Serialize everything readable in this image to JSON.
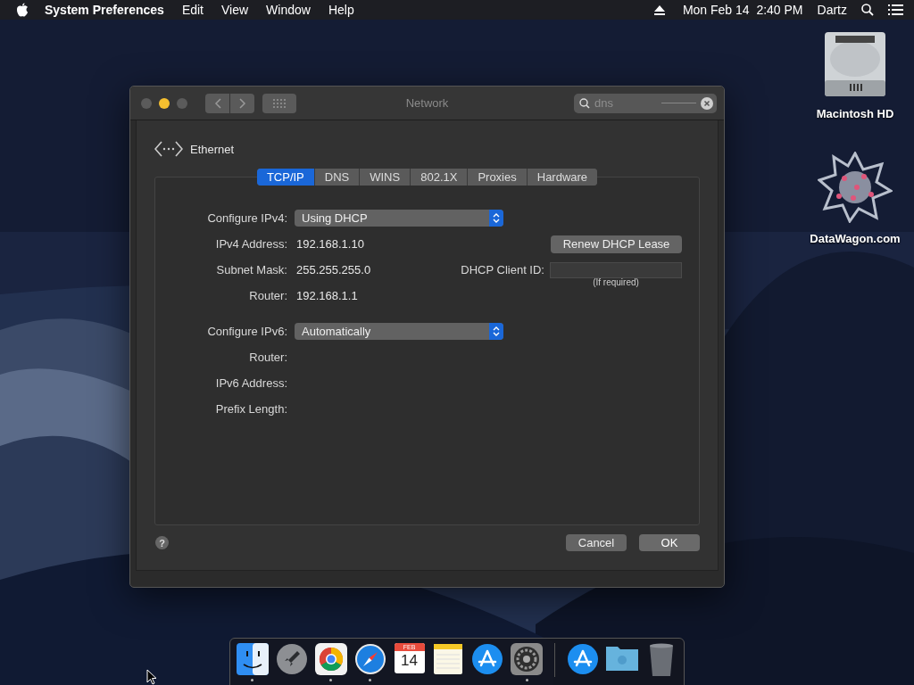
{
  "menu_bar": {
    "app_name": "System Preferences",
    "menus": [
      "Edit",
      "View",
      "Window",
      "Help"
    ],
    "clock": "Mon Feb 14  2:40 PM",
    "user": "Dartz"
  },
  "desktop_icons": [
    {
      "kind": "drive",
      "label": "Macintosh HD"
    },
    {
      "kind": "star",
      "label": "DataWagon.com"
    }
  ],
  "window": {
    "title": "Network",
    "search": {
      "value": "dns"
    },
    "service": "Ethernet",
    "tabs": [
      {
        "label": "TCP/IP",
        "selected": true
      },
      {
        "label": "DNS",
        "selected": false
      },
      {
        "label": "WINS",
        "selected": false
      },
      {
        "label": "802.1X",
        "selected": false
      },
      {
        "label": "Proxies",
        "selected": false
      },
      {
        "label": "Hardware",
        "selected": false
      }
    ],
    "ipv4_rows": [
      {
        "label": "Configure IPv4:",
        "kind": "popup",
        "value": "Using DHCP"
      },
      {
        "label": "IPv4 Address:",
        "kind": "text",
        "value": "192.168.1.10"
      },
      {
        "label": "Subnet Mask:",
        "kind": "text",
        "value": "255.255.255.0"
      },
      {
        "label": "Router:",
        "kind": "text",
        "value": "192.168.1.1"
      }
    ],
    "renew_button": "Renew DHCP Lease",
    "client_id": {
      "label": "DHCP Client ID:",
      "hint": "(If required)"
    },
    "ipv6_rows": [
      {
        "label": "Configure IPv6:",
        "kind": "popup",
        "value": "Automatically"
      },
      {
        "label": "Router:",
        "kind": "text"
      },
      {
        "label": "IPv6 Address:",
        "kind": "text"
      },
      {
        "label": "Prefix Length:",
        "kind": "text"
      }
    ],
    "help_button": "?",
    "buttons": [
      {
        "label": "Cancel",
        "kind": "cancel"
      },
      {
        "label": "OK",
        "kind": "ok"
      }
    ]
  },
  "dock": {
    "apps": [
      {
        "kind": "finder",
        "running": true
      },
      {
        "kind": "launchpad",
        "running": false
      },
      {
        "kind": "chrome",
        "running": true
      },
      {
        "kind": "safari",
        "running": true
      },
      {
        "kind": "calendar",
        "running": false,
        "month": "FEB",
        "day": "14"
      },
      {
        "kind": "notes",
        "running": false
      },
      {
        "kind": "appstore",
        "running": false
      },
      {
        "kind": "settings",
        "running": true
      }
    ],
    "stacks": [
      {
        "kind": "appstore"
      },
      {
        "kind": "folder"
      },
      {
        "kind": "trash"
      }
    ]
  }
}
